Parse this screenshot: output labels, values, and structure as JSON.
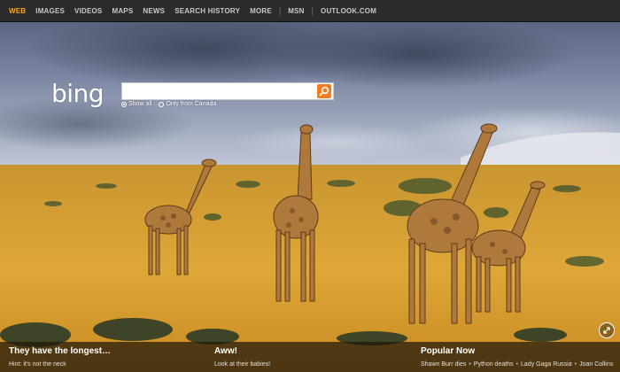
{
  "nav": {
    "items": [
      {
        "label": "WEB",
        "active": true
      },
      {
        "label": "IMAGES"
      },
      {
        "label": "VIDEOS"
      },
      {
        "label": "MAPS"
      },
      {
        "label": "NEWS"
      },
      {
        "label": "SEARCH HISTORY"
      },
      {
        "label": "MORE"
      }
    ],
    "msn": "MSN",
    "outlook": "OUTLOOK.COM"
  },
  "logo": "bing",
  "search": {
    "value": "",
    "placeholder": "",
    "scope_all": "Show all",
    "scope_country": "Only from Canada",
    "selected": "Show all"
  },
  "bottom": {
    "left_title": "They have the longest…",
    "left_sub": "Hint: it's not the neck",
    "mid_title": "Aww!",
    "mid_sub": "Look at their babies!",
    "popular_title": "Popular Now",
    "popular_items": [
      "Shawn Burr dies",
      "Python deaths",
      "Lady Gaga Russia",
      "Joan Collins"
    ]
  },
  "colors": {
    "accent": "#f47b20",
    "nav_active": "#f5a623",
    "nav_bg": "#2b2b2b"
  }
}
